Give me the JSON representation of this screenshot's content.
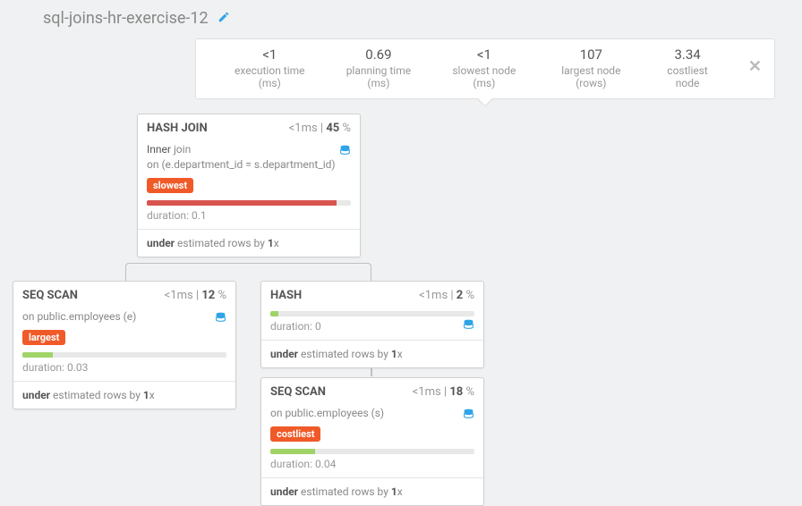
{
  "title": "sql-joins-hr-exercise-12",
  "stats": [
    {
      "v": "<1",
      "l": "execution time (ms)"
    },
    {
      "v": "0.69",
      "l": "planning time (ms)"
    },
    {
      "v": "<1",
      "l": "slowest node (ms)"
    },
    {
      "v": "107",
      "l": "largest node (rows)"
    },
    {
      "v": "3.34",
      "l": "costliest node"
    }
  ],
  "n0": {
    "name": "HASH JOIN",
    "time": "<1ms",
    "pct": "45",
    "d1": "Inner",
    "d2": "join",
    "d3": "on (e.department_id = s.department_id)",
    "tag": "slowest",
    "dur": "duration: 0.1",
    "foot1": "under",
    "foot2": " estimated rows by ",
    "foot3": "1",
    "foot4": "x"
  },
  "n1": {
    "name": "SEQ SCAN",
    "time": "<1ms",
    "pct": "12",
    "d1": "on public.employees (e)",
    "tag": "largest",
    "dur": "duration: 0.03",
    "foot1": "under",
    "foot2": " estimated rows by ",
    "foot3": "1",
    "foot4": "x"
  },
  "n2": {
    "name": "HASH",
    "time": "<1ms",
    "pct": "2",
    "dur": "duration: 0",
    "foot1": "under",
    "foot2": " estimated rows by ",
    "foot3": "1",
    "foot4": "x"
  },
  "n3": {
    "name": "SEQ SCAN",
    "time": "<1ms",
    "pct": "18",
    "d1": "on public.employees (s)",
    "tag": "costliest",
    "dur": "duration: 0.04",
    "foot1": "under",
    "foot2": " estimated rows by ",
    "foot3": "1",
    "foot4": "x"
  }
}
